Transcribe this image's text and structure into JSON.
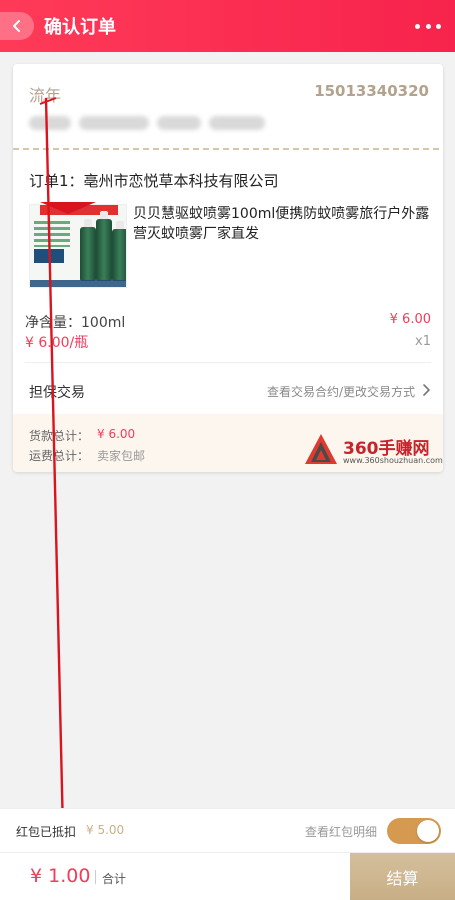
{
  "header": {
    "title": "确认订单"
  },
  "address": {
    "name": "流年",
    "phone": "15013340320"
  },
  "order": {
    "store": "订单1：亳州市恋悦草本科技有限公司",
    "product_title": "贝贝慧驱蚊喷雾100ml便携防蚊喷雾旅行户外露营灭蚊喷雾厂家直发",
    "spec": "净含量：100ml",
    "price": "¥ 6.00",
    "unit_price": "¥ 6.00/瓶",
    "quantity": "x1",
    "escrow_label": "担保交易",
    "escrow_link": "查看交易合约/更改交易方式"
  },
  "summary": {
    "goods_label": "货款总计：",
    "goods_value": "¥ 6.00",
    "shipping_label": "运费总计：",
    "shipping_value": "卖家包邮"
  },
  "watermark": {
    "name": "360手赚网",
    "url": "www.360shouzhuan.com"
  },
  "red_packet": {
    "label": "红包已抵扣",
    "amount": "¥ 5.00",
    "link": "查看红包明细",
    "enabled": true
  },
  "footer": {
    "total": "¥ 1.00",
    "total_label": "合计",
    "checkout_label": "结算"
  },
  "colors": {
    "header": "#f7234c",
    "price": "#f43b5a",
    "checkout": "#c8ae86",
    "toggle": "#d59a4f"
  }
}
